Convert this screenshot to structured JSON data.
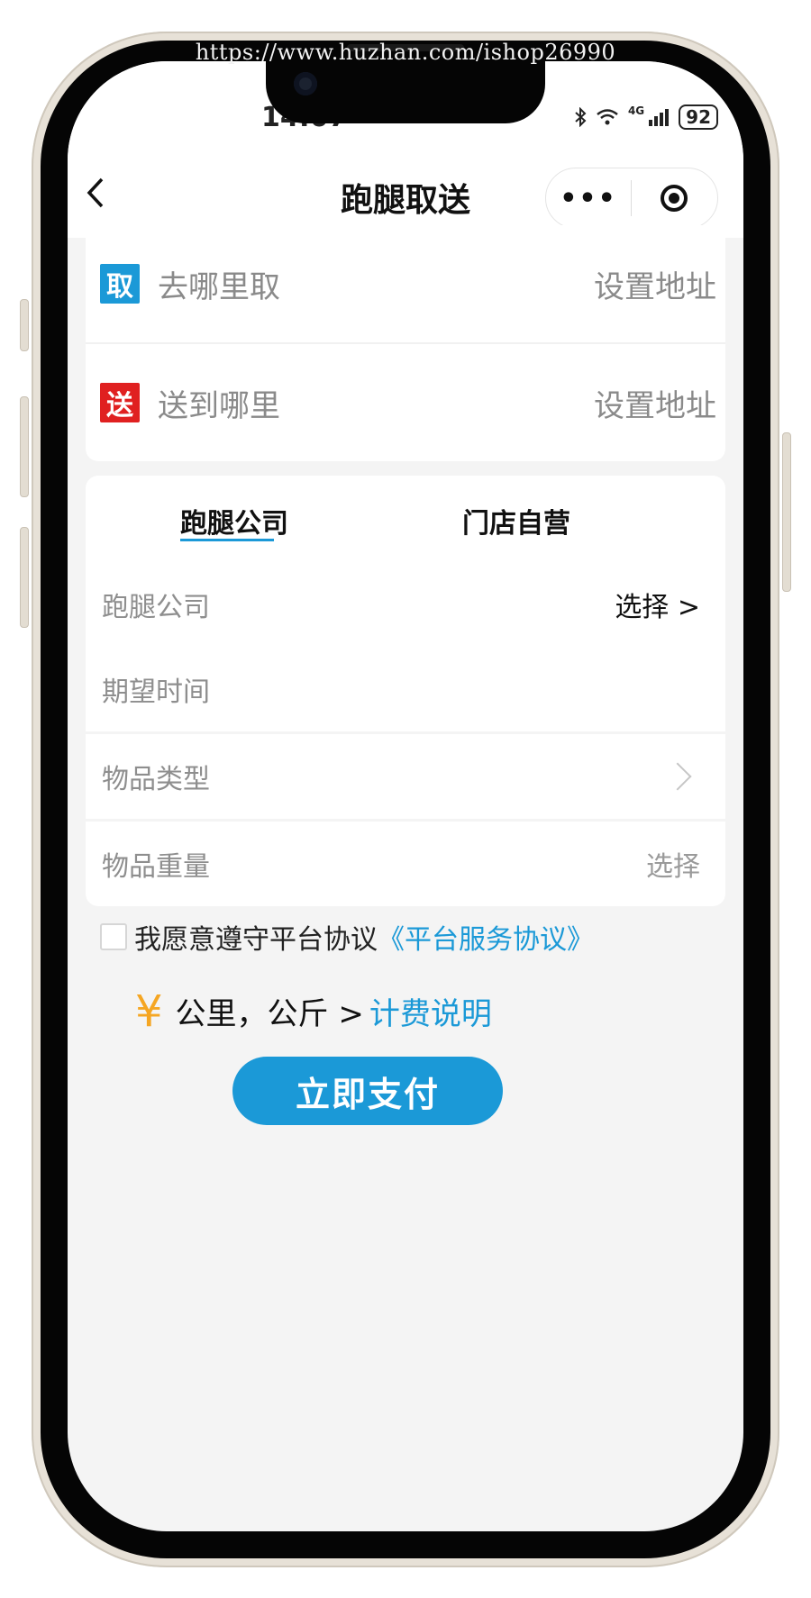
{
  "watermark": "https://www.huzhan.com/ishop26990",
  "status_bar": {
    "time": "14:07",
    "icons": [
      "bluetooth-icon",
      "wifi-icon",
      "signal-icon"
    ],
    "network_label": "4G",
    "battery": "92"
  },
  "nav": {
    "back_icon": "chevron-left-icon",
    "title": "跑腿取送",
    "more_icon": "•••",
    "target_icon": "target-icon"
  },
  "address": {
    "pickup": {
      "badge": "取",
      "badge_color": "#1b99d7",
      "label": "去哪里取",
      "action": "设置地址"
    },
    "dropoff": {
      "badge": "送",
      "badge_color": "#e02020",
      "label": "送到哪里",
      "action": "设置地址"
    }
  },
  "tabs": [
    {
      "label": "跑腿公司",
      "active": true
    },
    {
      "label": "门店自营",
      "active": false
    }
  ],
  "form": {
    "company": {
      "label": "跑腿公司",
      "value": "选择 >"
    },
    "time": {
      "label": "期望时间"
    },
    "item_type": {
      "label": "物品类型"
    },
    "item_weight": {
      "label": "物品重量",
      "value": "选择"
    }
  },
  "agreement": {
    "text": "我愿意遵守平台协议",
    "link": "《平台服务协议》"
  },
  "fee": {
    "currency": "¥",
    "units": "公里，公斤 >",
    "link": "计费说明"
  },
  "pay_button": "立即支付",
  "colors": {
    "accent": "#1b99d7",
    "pickup_badge": "#1b99d7",
    "dropoff_badge": "#e02020",
    "currency": "#f5a623",
    "background": "#f4f4f4"
  }
}
